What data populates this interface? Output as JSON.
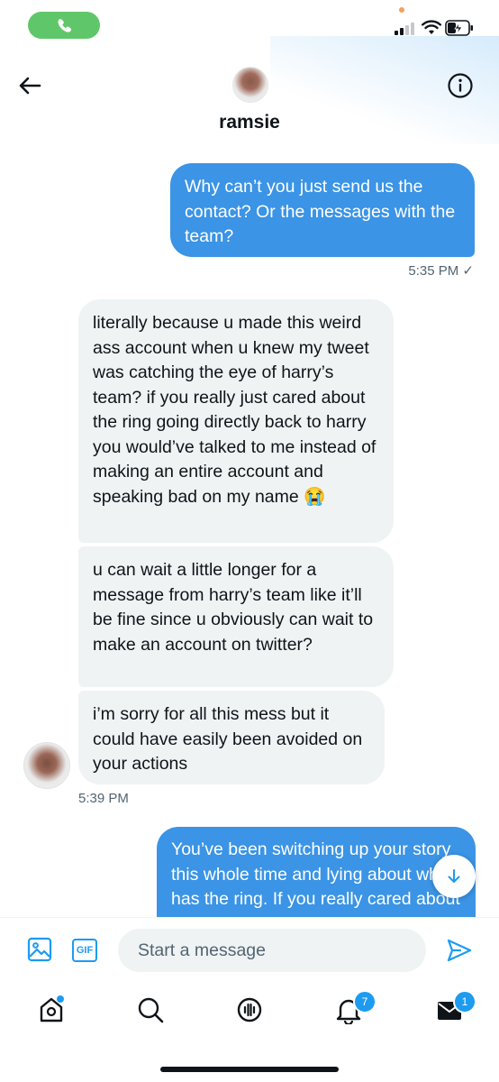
{
  "contact": {
    "name": "ramsie"
  },
  "messages": [
    {
      "text": "Why can’t you just send us the contact? Or the messages with the team?",
      "direction": "outgoing"
    },
    {
      "text": "5:35 PM ✓"
    },
    {
      "text": "literally because u made this weird ass account when u knew my tweet was catching the eye of harry’s team? if you really just cared about the ring going directly back to harry you would’ve talked to me instead of making an entire account and speaking bad on my name 😭",
      "direction": "incoming"
    },
    {
      "text": "u can wait a little longer for a message from harry’s team like it’ll be fine since u obviously can wait to make an account on twitter?",
      "direction": "incoming"
    },
    {
      "text": "i’m sorry for all this mess but it could have easily been avoided on your actions",
      "direction": "incoming"
    },
    {
      "text": "5:39 PM"
    },
    {
      "text": "You’ve been switching up your story this whole time and lying about who has the ring. If you really cared about getting the",
      "direction": "outgoing"
    }
  ],
  "composer": {
    "placeholder": "Start a message",
    "gif_label": "GIF"
  },
  "tabs": {
    "notifications_badge": "7",
    "messages_badge": "1"
  },
  "icons": {
    "back": "arrow-left-icon",
    "info": "info-icon",
    "media": "image-icon",
    "send": "send-icon",
    "scroll": "arrow-down-icon",
    "call": "phone-icon"
  },
  "colors": {
    "outgoing_bubble": "#3b94e5",
    "incoming_bubble": "#eff3f4",
    "accent": "#1d9bf0",
    "call_pill": "#5fc76a"
  }
}
